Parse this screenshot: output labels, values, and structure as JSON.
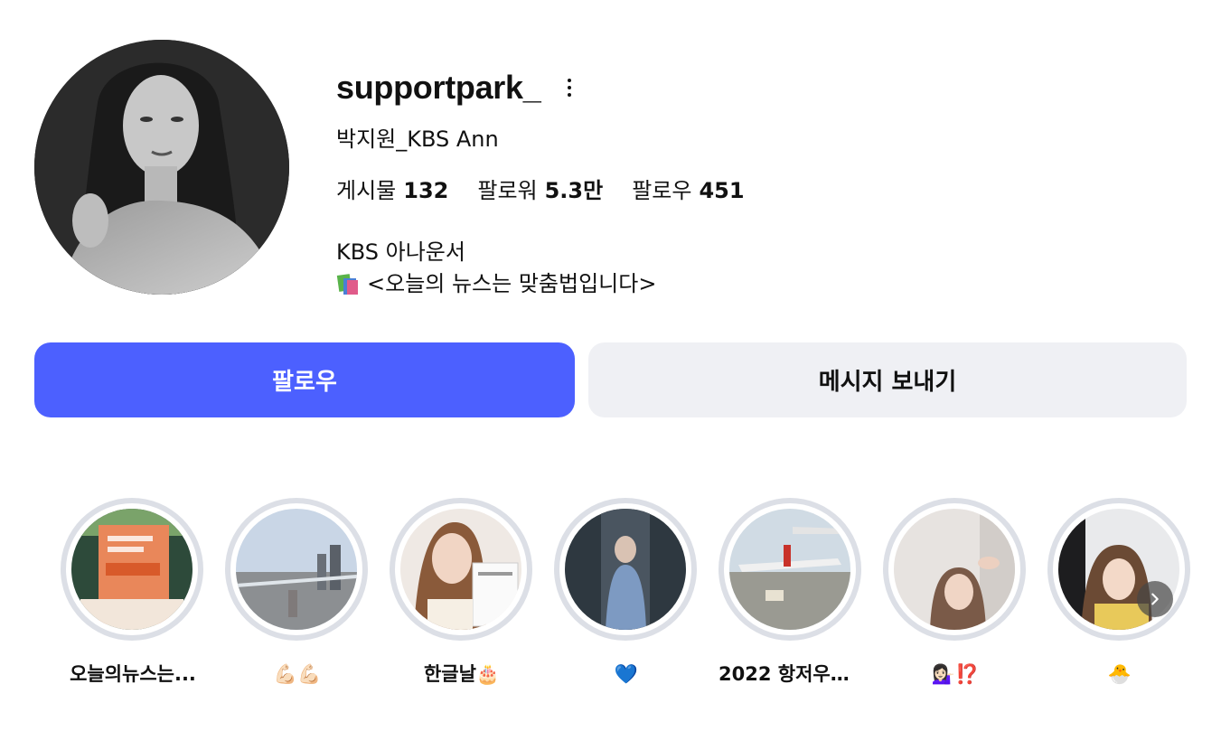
{
  "profile": {
    "username": "supportpark_",
    "full_name": "박지원_KBS Ann",
    "stats": [
      {
        "label": "게시물",
        "value": "132"
      },
      {
        "label": "팔로워",
        "value": "5.3만"
      },
      {
        "label": "팔로우",
        "value": "451"
      }
    ],
    "bio_line1": "KBS 아나운서",
    "bio_line2": "<오늘의 뉴스는 맞춤법입니다>",
    "avatar_icon": "profile-photo",
    "more_icon": "more-vertical-icon"
  },
  "actions": {
    "follow_label": "팔로우",
    "message_label": "메시지 보내기"
  },
  "highlights": [
    {
      "label": "오늘의뉴스는..."
    },
    {
      "label": "💪🏻💪🏻"
    },
    {
      "label": "한글날🎂"
    },
    {
      "label": "💙"
    },
    {
      "label": "2022 항저우아..."
    },
    {
      "label": "💁🏻‍♀️⁉️"
    },
    {
      "label": "🐣"
    }
  ],
  "colors": {
    "follow_button": "#4c60ff",
    "message_button": "#eff0f4",
    "highlight_ring": "#dcdfe6"
  }
}
